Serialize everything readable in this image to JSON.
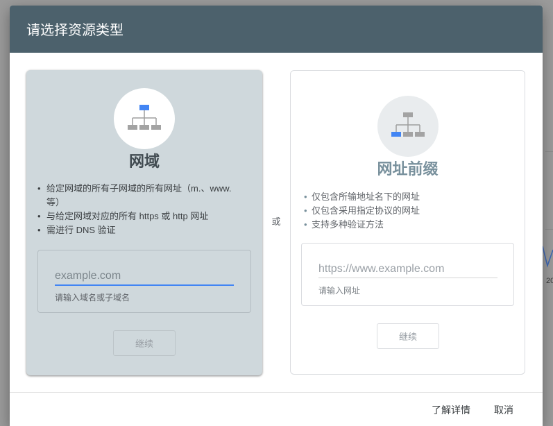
{
  "background": {
    "fragment_text": "20"
  },
  "dialog": {
    "title": "请选择资源类型",
    "or_label": "或"
  },
  "domain": {
    "icon": "sitemap-icon",
    "title": "网域",
    "bullets": [
      "给定网域的所有子网域的所有网址（m.、www. 等）",
      "与给定网域对应的所有 https 或 http 网址",
      "需进行 DNS 验证"
    ],
    "input": {
      "placeholder": "example.com",
      "value": ""
    },
    "helper": "请输入域名或子域名",
    "continue_label": "继续"
  },
  "url_prefix": {
    "icon": "sitemap-icon",
    "title": "网址前缀",
    "bullets": [
      "仅包含所输地址名下的网址",
      "仅包含采用指定协议的网址",
      "支持多种验证方法"
    ],
    "input": {
      "placeholder": "https://www.example.com",
      "value": ""
    },
    "helper": "请输入网址",
    "continue_label": "继续"
  },
  "footer": {
    "learn_more_label": "了解详情",
    "cancel_label": "取消"
  },
  "colors": {
    "header": "#4c616c",
    "accent": "#4285f4",
    "selected_card": "#cfd8dc"
  }
}
